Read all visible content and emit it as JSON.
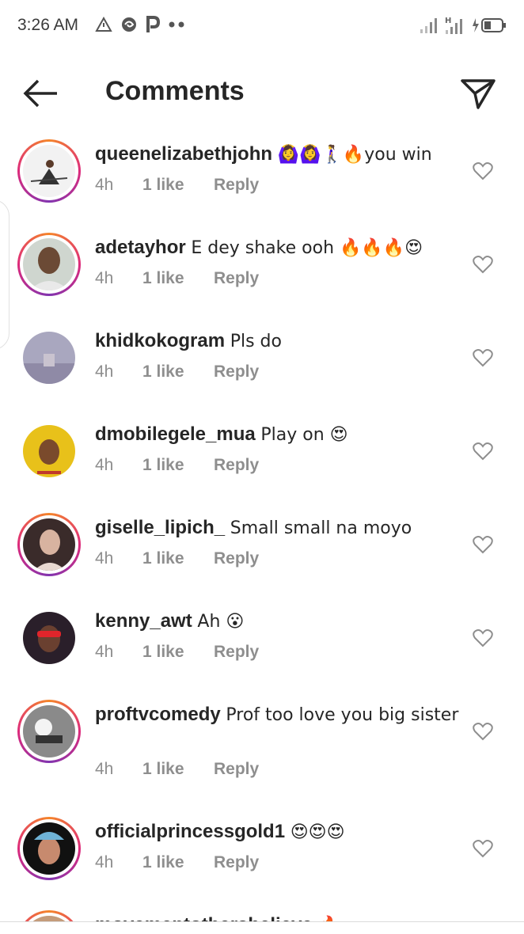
{
  "status_bar": {
    "time": "3:26 AM",
    "left_icons": [
      "warning-triangle-icon",
      "swirl-icon",
      "p-icon",
      "more-dots-icon"
    ],
    "right_icons": [
      "signal-bars-icon",
      "signal-h-bars-icon",
      "battery-charging-icon"
    ]
  },
  "header": {
    "title": "Comments",
    "back_icon": "back-arrow-icon",
    "send_icon": "paper-plane-icon"
  },
  "colors": {
    "text": "#262626",
    "meta": "#8e8e8e",
    "story_ring_start": "#f58529",
    "story_ring_end": "#dd2a7b"
  },
  "comments": [
    {
      "username": "queenelizabethjohn",
      "text": "🙆‍♀️🙆‍♀️🚶‍♀️🔥you win",
      "time": "4h",
      "likes": "1 like",
      "reply": "Reply",
      "ring": true
    },
    {
      "username": "adetayhor",
      "text": "E dey shake ooh 🔥🔥🔥😍",
      "time": "4h",
      "likes": "1 like",
      "reply": "Reply",
      "ring": true
    },
    {
      "username": "khidkokogram",
      "text": "Pls do",
      "time": "4h",
      "likes": "1 like",
      "reply": "Reply",
      "ring": false
    },
    {
      "username": "dmobilegele_mua",
      "text": "Play on 😍",
      "time": "4h",
      "likes": "1 like",
      "reply": "Reply",
      "ring": false
    },
    {
      "username": "giselle_lipich_",
      "text": "Small small na moyo",
      "time": "4h",
      "likes": "1 like",
      "reply": "Reply",
      "ring": true
    },
    {
      "username": "kenny_awt",
      "text": "Ah 😮",
      "time": "4h",
      "likes": "1 like",
      "reply": "Reply",
      "ring": false
    },
    {
      "username": "proftvcomedy",
      "text": "Prof too love you big sister",
      "time": "4h",
      "likes": "1 like",
      "reply": "Reply",
      "ring": true
    },
    {
      "username": "officialprincessgold1",
      "text": "😍😍😍",
      "time": "4h",
      "likes": "1 like",
      "reply": "Reply",
      "ring": true
    },
    {
      "username": "movementothersbelieve",
      "text": "🔥",
      "time": "",
      "likes": "",
      "reply": "",
      "ring": true
    }
  ]
}
